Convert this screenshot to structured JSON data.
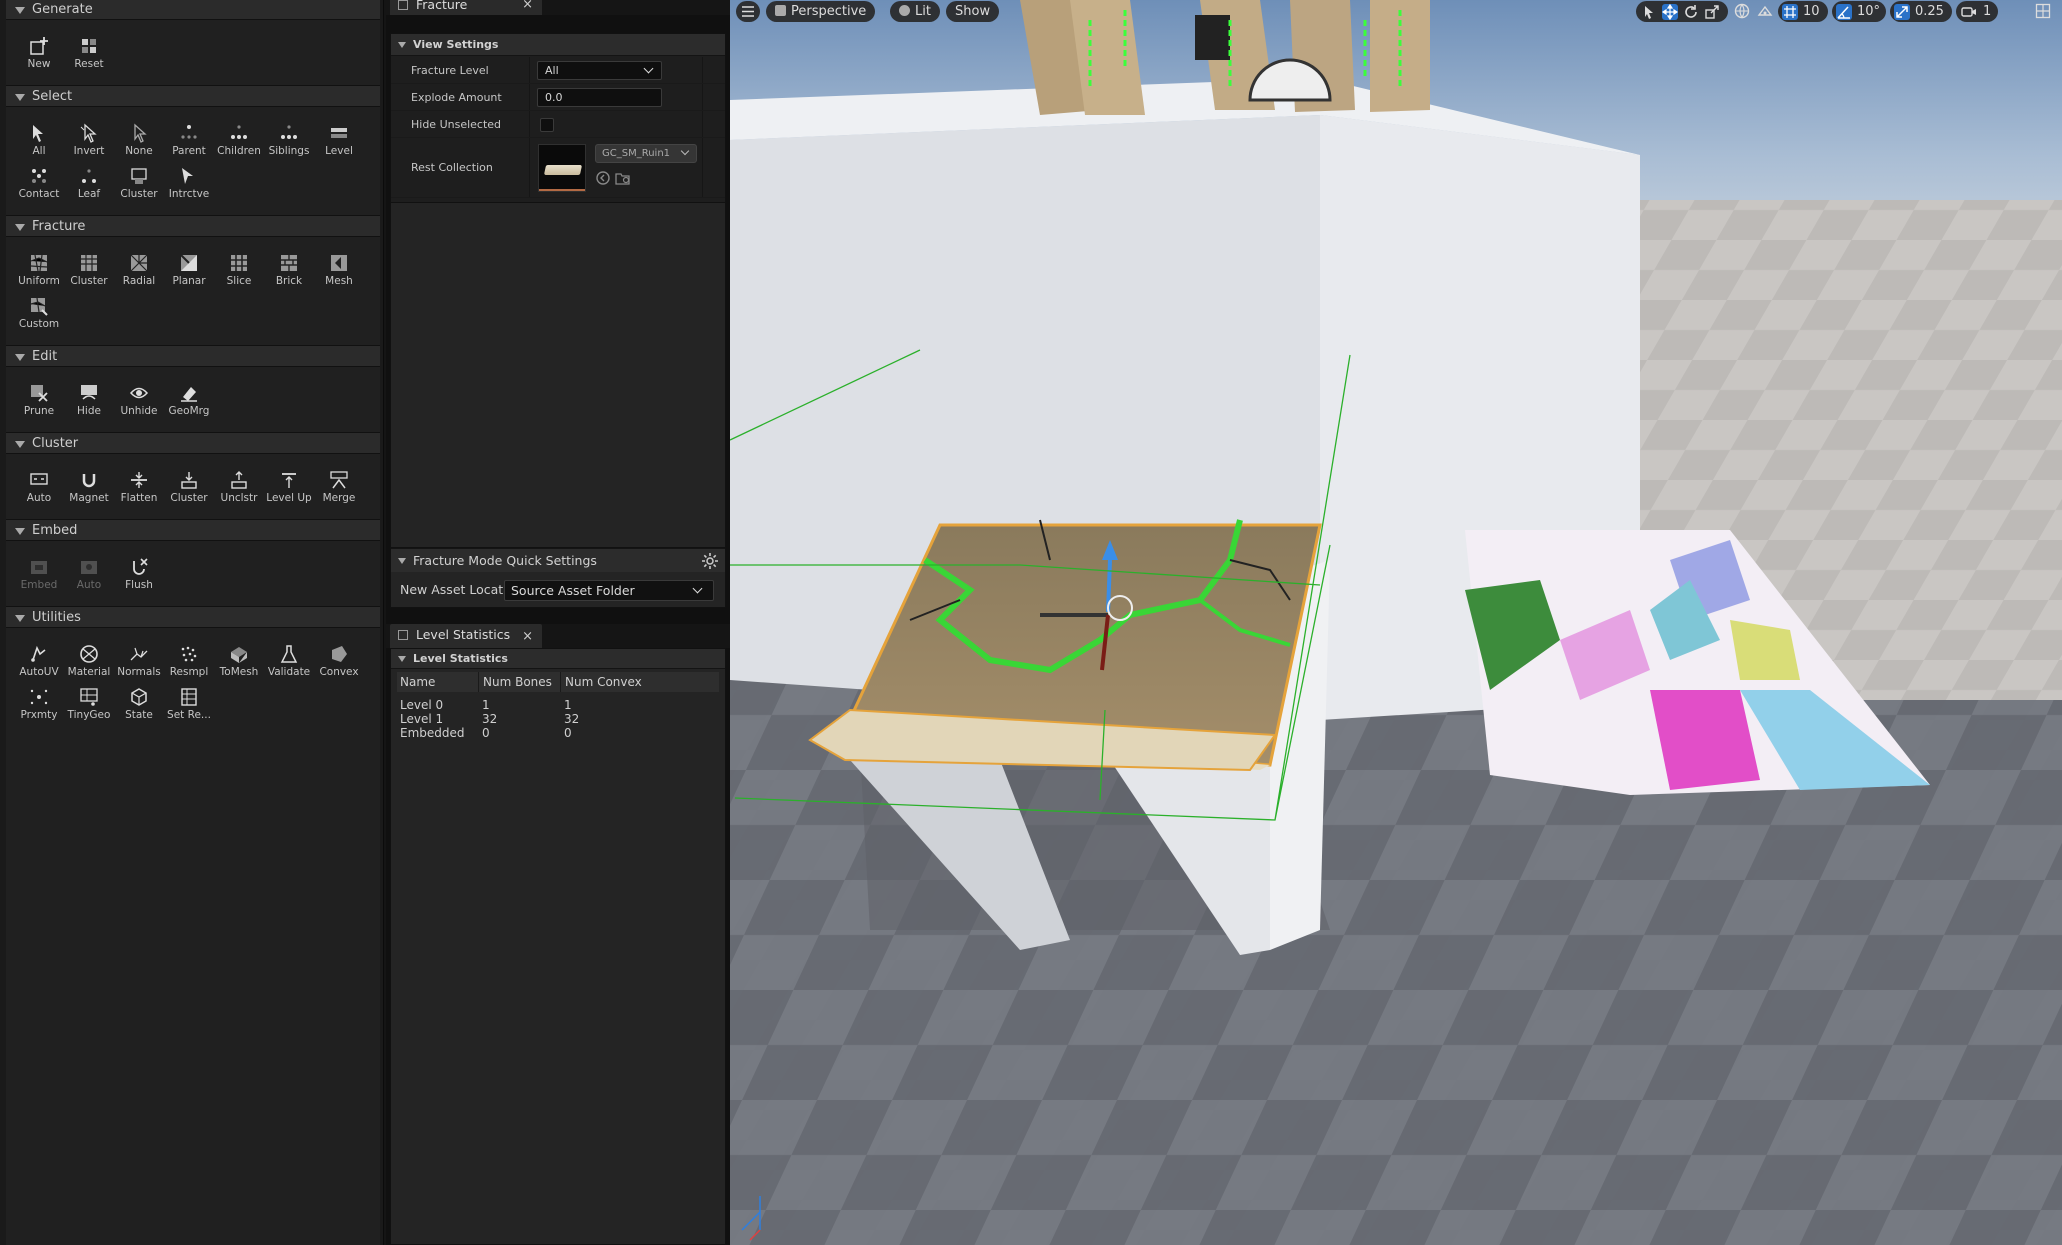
{
  "palette": {
    "sections": {
      "generate": "Generate",
      "select": "Select",
      "fracture": "Fracture",
      "edit": "Edit",
      "cluster": "Cluster",
      "embed": "Embed",
      "utilities": "Utilities"
    },
    "generate": [
      "New",
      "Reset"
    ],
    "select": [
      "All",
      "Invert",
      "None",
      "Parent",
      "Children",
      "Siblings",
      "Level",
      "Contact",
      "Leaf",
      "Cluster",
      "Intrctve"
    ],
    "fracture": [
      "Uniform",
      "Cluster",
      "Radial",
      "Planar",
      "Slice",
      "Brick",
      "Mesh",
      "Custom"
    ],
    "edit": [
      "Prune",
      "Hide",
      "Unhide",
      "GeoMrg"
    ],
    "cluster": [
      "Auto",
      "Magnet",
      "Flatten",
      "Cluster",
      "Unclstr",
      "Level Up",
      "Merge"
    ],
    "embed": [
      "Embed",
      "Auto",
      "Flush"
    ],
    "utilities": [
      "AutoUV",
      "Material",
      "Normals",
      "Resmpl",
      "ToMesh",
      "Validate",
      "Convex",
      "Prxmty",
      "TinyGeo",
      "State",
      "Set Re..."
    ]
  },
  "fracture_panel": {
    "tab_title": "Fracture",
    "close": "×",
    "category": "View Settings",
    "fracture_level_label": "Fracture Level",
    "fracture_level_value": "All",
    "explode_amount_label": "Explode Amount",
    "explode_amount_value": "0.0",
    "hide_unselected_label": "Hide Unselected",
    "rest_collection_label": "Rest Collection",
    "rest_collection_asset": "GC_SM_Ruin1",
    "quick_settings_title": "Fracture Mode Quick Settings",
    "new_asset_location_label": "New Asset Location",
    "new_asset_location_value": "Source Asset Folder"
  },
  "level_stats": {
    "tab_title": "Level Statistics",
    "close": "×",
    "category": "Level Statistics",
    "columns": [
      "Name",
      "Num Bones",
      "Num Convex"
    ],
    "rows": [
      [
        "Level 0",
        "1",
        "1"
      ],
      [
        "Level 1",
        "32",
        "32"
      ],
      [
        "Embedded",
        "0",
        "0"
      ]
    ]
  },
  "viewport": {
    "view_mode": "Perspective",
    "lighting": "Lit",
    "show": "Show",
    "grid_snap": "10",
    "rotation_snap": "10°",
    "scale_snap": "0.25",
    "camera_speed": "1",
    "accent": "#2a72c8"
  }
}
